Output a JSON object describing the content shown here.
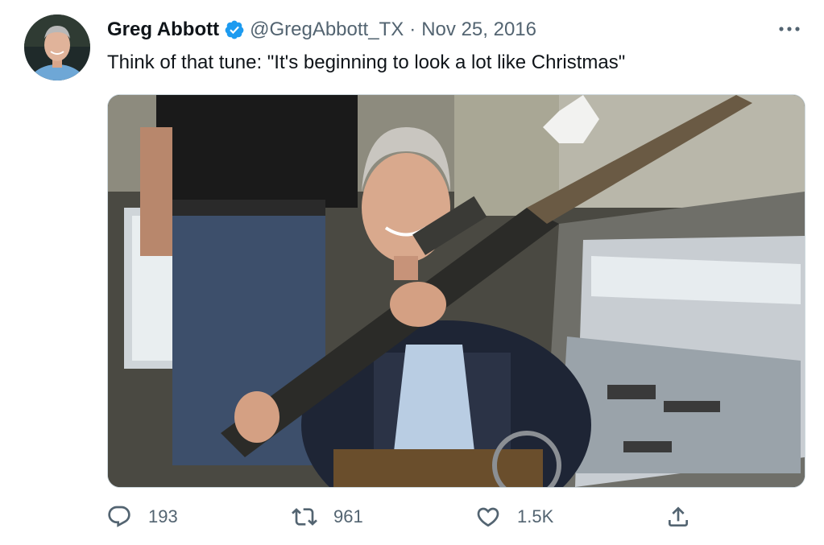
{
  "tweet": {
    "author_name": "Greg Abbott",
    "handle": "@GregAbbott_TX",
    "separator": "·",
    "date": "Nov 25, 2016",
    "text": "Think of that tune: \"It's beginning to look a lot like Christmas\"",
    "avatar_icon": "profile-photo",
    "verified_icon": "verified-badge-icon",
    "more_icon": "more-options-icon",
    "media_description_icon": "photo"
  },
  "actions": {
    "reply_count": "193",
    "retweet_count": "961",
    "like_count": "1.5K",
    "reply_icon": "reply-icon",
    "retweet_icon": "retweet-icon",
    "like_icon": "heart-icon",
    "share_icon": "share-icon"
  },
  "colors": {
    "text_primary": "#0f1419",
    "text_secondary": "#536471",
    "verified_blue": "#1d9bf0",
    "border": "#cfd9de",
    "background": "#ffffff"
  }
}
